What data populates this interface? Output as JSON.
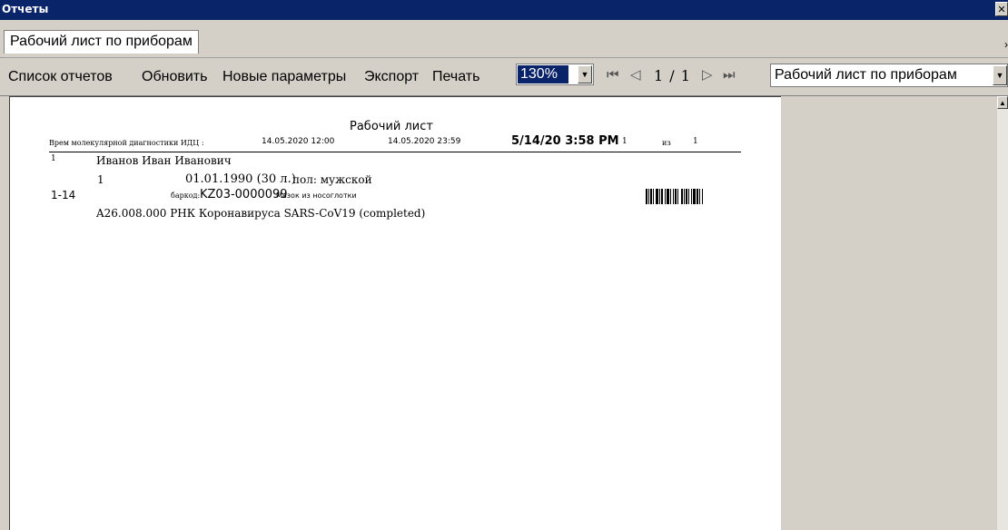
{
  "window": {
    "title": "Отчеты",
    "close_glyph": "✕"
  },
  "tabs": [
    {
      "label": "Рабочий лист по приборам"
    }
  ],
  "tab_scroll_glyph": "›",
  "toolbar": {
    "report_list": "Список отчетов",
    "refresh": "Обновить",
    "new_params": "Новые параметры",
    "export": "Экспорт",
    "print": "Печать",
    "zoom": "130%",
    "pager": "1 / 1",
    "report_select": "Рабочий лист по приборам"
  },
  "icons": {
    "first": "first-page-icon",
    "prev": "prev-page-icon",
    "next": "next-page-icon",
    "last": "last-page-icon",
    "dropdown": "chevron-down-icon"
  },
  "glyphs": {
    "first": "⏮",
    "prev": "◁",
    "next": "▷",
    "last": "⏭",
    "dropdown": "▼",
    "scroll_up": "▲"
  },
  "report": {
    "heading": "Рабочий лист",
    "department": "Врем молекулярной диагностики ИДЦ :",
    "date_from": "14.05.2020 12:00",
    "date_to": "14.05.2020 23:59",
    "printed": "5/14/20 3:58 PM",
    "page": "1",
    "of_label": "из",
    "pages": "1",
    "rows": [
      {
        "index": "1",
        "patient": "Иванов Иван Иванович",
        "sub_index": "1",
        "dob": "01.01.1990 (30 л.)",
        "sex": "пол: мужской",
        "sample_no": "1-14",
        "barcode_label": "баркод:",
        "barcode": "KZ03-0000099",
        "specimen": "Мазок из носоглотки",
        "test": "A26.008.000 РНК Коронавируса SARS-CoV19 (completed)"
      }
    ]
  }
}
